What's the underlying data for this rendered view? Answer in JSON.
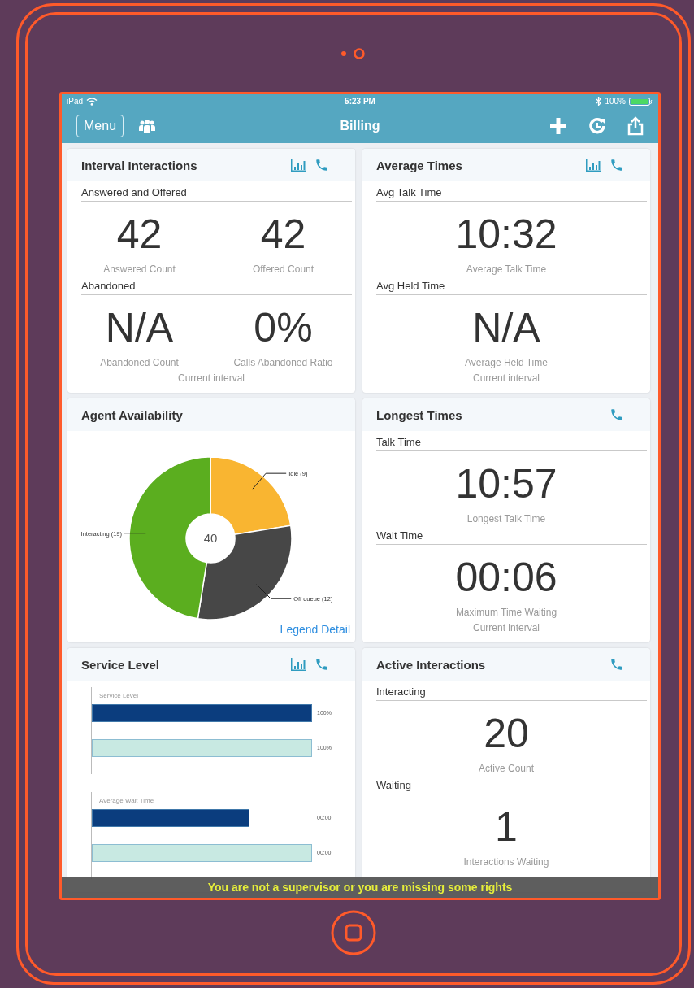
{
  "status_bar": {
    "carrier": "iPad",
    "time": "5:23 PM",
    "battery": "100%"
  },
  "nav_bar": {
    "menu_button": "Menu",
    "title": "Billing"
  },
  "cards": [
    {
      "kind": "metrics",
      "title": "Interval Interactions",
      "chart_button": true,
      "sections": [
        {
          "label": "Answered and Offered",
          "metrics": [
            {
              "value": "42",
              "caption": "Answered Count"
            },
            {
              "value": "42",
              "caption": "Offered Count"
            }
          ]
        },
        {
          "label": "Abandoned",
          "metrics": [
            {
              "value": "N/A",
              "caption": "Abandoned Count"
            },
            {
              "value": "0%",
              "caption": "Calls Abandoned Ratio"
            }
          ]
        }
      ],
      "footer": "Current interval"
    },
    {
      "kind": "metrics",
      "title": "Average Times",
      "chart_button": true,
      "sections": [
        {
          "label": "Avg Talk Time",
          "metrics": [
            {
              "value": "10:32",
              "caption": "Average Talk Time"
            }
          ]
        },
        {
          "label": "Avg Held Time",
          "metrics": [
            {
              "value": "N/A",
              "caption": "Average Held Time"
            }
          ]
        }
      ],
      "footer": "Current interval"
    },
    {
      "kind": "donut",
      "title": "Agent Availability",
      "link": "Legend Detail",
      "total": "40",
      "chart_data": {
        "type": "donut",
        "categories": [
          "Idle (9)",
          "Off queue (12)",
          "Interacting (19)"
        ],
        "values": [
          9,
          12,
          19
        ]
      }
    },
    {
      "kind": "metrics",
      "title": "Longest Times",
      "chart_button": false,
      "sections": [
        {
          "label": "Talk Time",
          "metrics": [
            {
              "value": "10:57",
              "caption": "Longest Talk Time"
            }
          ]
        },
        {
          "label": "Wait Time",
          "metrics": [
            {
              "value": "00:06",
              "caption": "Maximum Time Waiting"
            }
          ]
        }
      ],
      "footer": "Current interval"
    },
    {
      "kind": "bars",
      "title": "Service Level",
      "chart_button": true,
      "panels": [
        {
          "title": "Service Level",
          "bars": [
            {
              "level": 1,
              "reading": "100%",
              "color": "#0b3d7e"
            },
            {
              "level": 1,
              "reading": "100%",
              "color": "#c8e9e2"
            }
          ]
        },
        {
          "title": "Average Wait Time",
          "bars": [
            {
              "level": 0.715,
              "reading": "00:00",
              "color": "#0b3d7e"
            },
            {
              "level": 1,
              "reading": "00:00",
              "color": "#c8e9e2"
            }
          ]
        }
      ]
    },
    {
      "kind": "metrics",
      "title": "Active Interactions",
      "chart_button": false,
      "sections": [
        {
          "label": "Interacting",
          "metrics": [
            {
              "value": "20",
              "caption": "Active Count"
            }
          ]
        },
        {
          "label": "Waiting",
          "metrics": [
            {
              "value": "1",
              "caption": "Interactions Waiting"
            }
          ]
        }
      ]
    }
  ],
  "toast": "You are not a supervisor or you are missing some rights"
}
